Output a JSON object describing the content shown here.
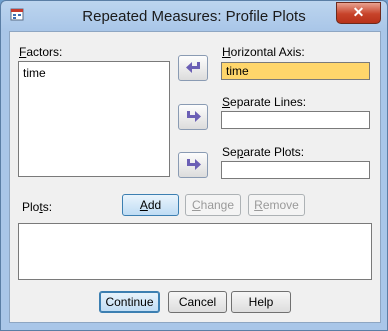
{
  "window": {
    "title": "Repeated Measures: Profile Plots",
    "close_glyph": "✕",
    "icon": "spss-dialog-icon"
  },
  "factors": {
    "label_accel": "F",
    "label_rest": "actors:",
    "items": [
      "time"
    ]
  },
  "horizontal_axis": {
    "label_accel": "H",
    "label_rest": "orizontal Axis:",
    "value": "time"
  },
  "separate_lines": {
    "label_accel": "S",
    "label_rest": "eparate Lines:",
    "value": ""
  },
  "separate_plots": {
    "label_pre": "Se",
    "label_accel": "p",
    "label_rest": "arate Plots:",
    "value": ""
  },
  "plots": {
    "label_pre": "Plo",
    "label_accel": "t",
    "label_rest": "s:",
    "add": {
      "accel": "A",
      "rest": "dd"
    },
    "change": {
      "accel": "C",
      "rest": "hange"
    },
    "remove": {
      "accel": "R",
      "rest": "emove"
    }
  },
  "footer": {
    "continue_label": "Continue",
    "cancel_label": "Cancel",
    "help_label": "Help"
  },
  "colors": {
    "arrow": "#6b5fb5",
    "highlight_field": "#ffd66b",
    "frame": "#a9c6e8"
  }
}
